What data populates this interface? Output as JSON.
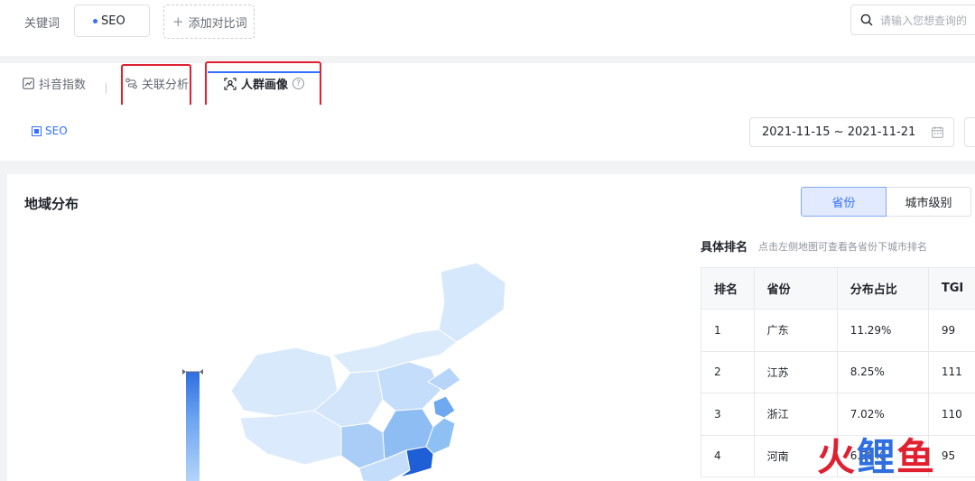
{
  "keyword_bar": {
    "label": "关键词",
    "chip": "SEO",
    "add_compare": "添加对比词",
    "search_placeholder": "请输入您想查询的"
  },
  "tabs": [
    {
      "label": "抖音指数",
      "icon": "trend-icon",
      "active": false
    },
    {
      "label": "关联分析",
      "icon": "link-analysis-icon",
      "active": false
    },
    {
      "label": "人群画像",
      "icon": "portrait-icon",
      "active": true
    }
  ],
  "help_glyph": "?",
  "filter": {
    "legend_chip": "SEO",
    "date_range": "2021-11-15 ~ 2021-11-21"
  },
  "region": {
    "title": "地域分布",
    "segments": [
      {
        "label": "省份",
        "active": true
      },
      {
        "label": "城市级别",
        "active": false
      }
    ],
    "ranking_title": "具体排名",
    "ranking_hint": "点击左侧地图可查看各省份下城市排名",
    "columns": [
      "排名",
      "省份",
      "分布占比",
      "TGI"
    ],
    "rows": [
      {
        "rank": "1",
        "province": "广东",
        "share": "11.29%",
        "tgi": "99"
      },
      {
        "rank": "2",
        "province": "江苏",
        "share": "8.25%",
        "tgi": "111"
      },
      {
        "rank": "3",
        "province": "浙江",
        "share": "7.02%",
        "tgi": "110"
      },
      {
        "rank": "4",
        "province": "河南",
        "share": "6.38%",
        "tgi": "95"
      }
    ]
  },
  "watermark": {
    "char1": "火",
    "char2": "鲤",
    "char3": "鱼",
    "color1": "#e0202f",
    "color2": "#2f6fe0",
    "color3": "#e0202f"
  },
  "colors": {
    "accent": "#3370ff",
    "highlight_box": "#e0202f",
    "map_high": "#1f5fd6",
    "map_low": "#d8e9fc"
  }
}
